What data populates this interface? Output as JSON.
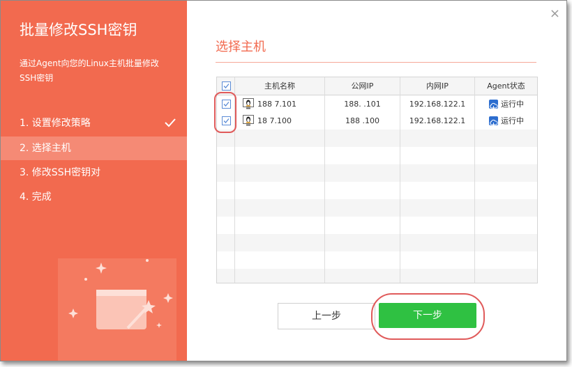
{
  "wizard": {
    "title": "批量修改SSH密钥",
    "description": "通过Agent向您的Linux主机批量修改SSH密钥",
    "steps": [
      {
        "label": "1. 设置修改策略",
        "done": true
      },
      {
        "label": "2. 选择主机",
        "active": true
      },
      {
        "label": "3. 修改SSH密钥对"
      },
      {
        "label": "4. 完成"
      }
    ]
  },
  "dialog": {
    "close": "×",
    "section_title": "选择主机"
  },
  "table": {
    "columns": [
      "主机名称",
      "公网IP",
      "内网IP",
      "Agent状态"
    ],
    "rows": [
      {
        "name": "188  7.101",
        "public_ip": "188.  .101",
        "private_ip": "192.168.122.1",
        "status": "运行中",
        "checked": true
      },
      {
        "name": "18  7.100",
        "public_ip": "188  .100",
        "private_ip": "192.168.122.1",
        "status": "运行中",
        "checked": true
      }
    ]
  },
  "buttons": {
    "prev": "上一步",
    "next": "下一步"
  },
  "colors": {
    "accent": "#f26a4f",
    "primary_button": "#2fc142",
    "highlight": "#e05a5a"
  }
}
